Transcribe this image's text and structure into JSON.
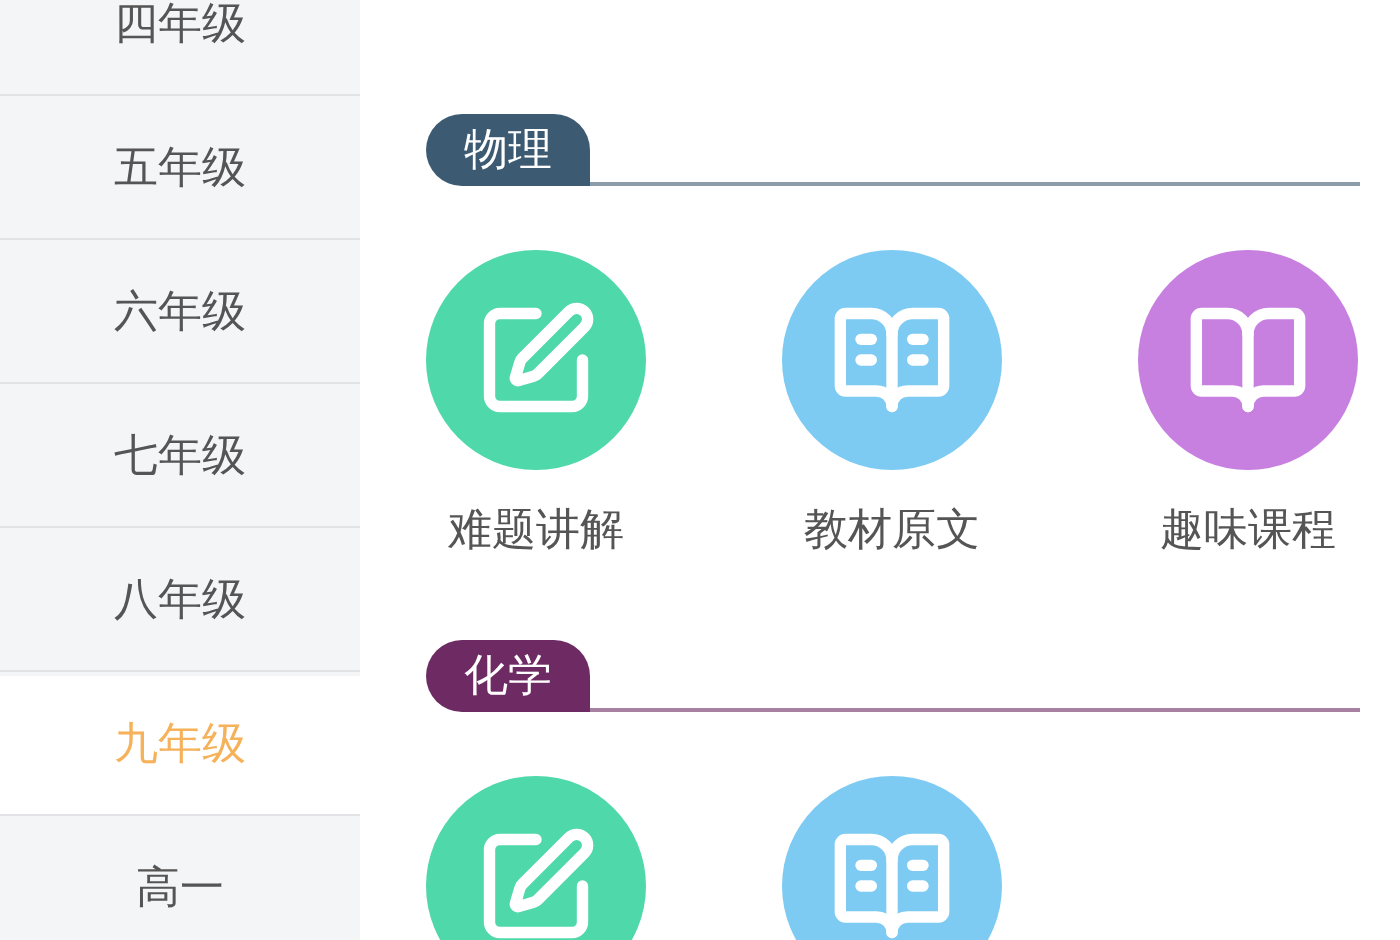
{
  "sidebar": {
    "items": [
      {
        "label": "四年级",
        "selected": false
      },
      {
        "label": "五年级",
        "selected": false
      },
      {
        "label": "六年级",
        "selected": false
      },
      {
        "label": "七年级",
        "selected": false
      },
      {
        "label": "八年级",
        "selected": false
      },
      {
        "label": "九年级",
        "selected": true
      },
      {
        "label": "高一",
        "selected": false
      }
    ]
  },
  "sections": [
    {
      "title": "物理",
      "color": "#3d5a73",
      "items": [
        {
          "kind": "edit",
          "label": "难题讲解",
          "color": "#4fd8a9"
        },
        {
          "kind": "text-book",
          "label": "教材原文",
          "color": "#7dcaf3"
        },
        {
          "kind": "book",
          "label": "趣味课程",
          "color": "#c77fe0"
        }
      ]
    },
    {
      "title": "化学",
      "color": "#6e2b63",
      "items": [
        {
          "kind": "edit",
          "color": "#4fd8a9"
        },
        {
          "kind": "text-book",
          "color": "#7dcaf3"
        }
      ]
    }
  ]
}
